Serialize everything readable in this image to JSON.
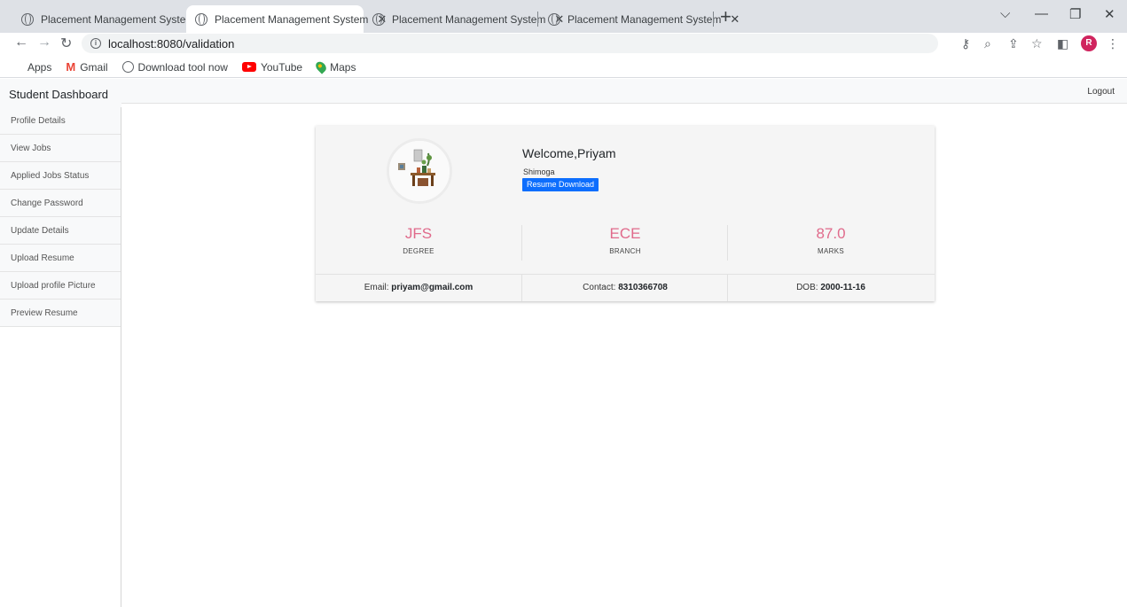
{
  "browser": {
    "tabs": [
      {
        "title": "Placement Management System"
      },
      {
        "title": "Placement Management System"
      },
      {
        "title": "Placement Management System"
      },
      {
        "title": "Placement Management System"
      }
    ],
    "url": "localhost:8080/validation",
    "profile_initial": "R",
    "bookmarks": [
      {
        "label": "Apps",
        "icon": "apps-grid-icon"
      },
      {
        "label": "Gmail",
        "icon": "gmail-icon"
      },
      {
        "label": "Download tool now",
        "icon": "globe-icon"
      },
      {
        "label": "YouTube",
        "icon": "youtube-icon"
      },
      {
        "label": "Maps",
        "icon": "maps-icon"
      }
    ]
  },
  "page": {
    "brand": "Student Dashboard",
    "logout": "Logout",
    "sidebar": [
      {
        "label": "Profile Details"
      },
      {
        "label": "View Jobs"
      },
      {
        "label": "Applied Jobs Status"
      },
      {
        "label": "Change Password"
      },
      {
        "label": "Update Details"
      },
      {
        "label": "Upload Resume"
      },
      {
        "label": "Upload profile Picture"
      },
      {
        "label": "Preview Resume"
      }
    ],
    "profile": {
      "welcome": "Welcome,Priyam",
      "city": "Shimoga",
      "resume_button": "Resume Download",
      "stats": [
        {
          "value": "JFS",
          "label": "DEGREE"
        },
        {
          "value": "ECE",
          "label": "BRANCH"
        },
        {
          "value": "87.0",
          "label": "MARKS"
        }
      ],
      "email_label": "Email:",
      "email": "priyam@gmail.com",
      "contact_label": "Contact:",
      "contact": "8310366708",
      "dob_label": "DOB:",
      "dob": "2000-11-16"
    }
  }
}
